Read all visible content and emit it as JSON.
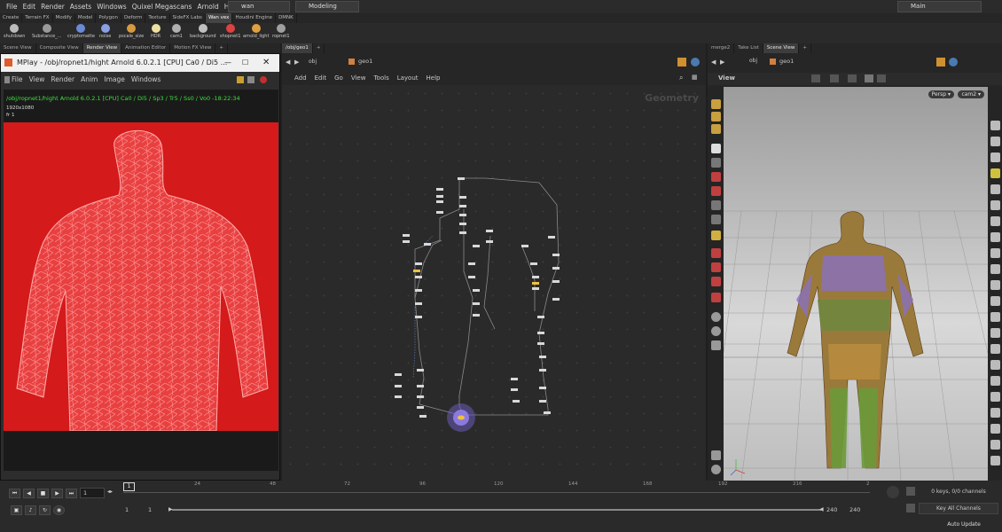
{
  "menubar": {
    "items": [
      "File",
      "Edit",
      "Render",
      "Assets",
      "Windows",
      "Quixel Megascans",
      "Arnold",
      "Help"
    ],
    "scene_name": "wan",
    "desktop": "Modeling",
    "main_label": "Main"
  },
  "shelf_tabs": [
    "Create",
    "Terrain FX",
    "Modify",
    "Model",
    "Polygon",
    "Deform",
    "Texture",
    "SideFX Labs",
    "Wan vex",
    "Houdini Engine",
    "DMNK"
  ],
  "shelf_active": "Wan vex",
  "shelf_tools": [
    {
      "label": "shutdown",
      "icon": "power-icon",
      "color": "#bbbbbb"
    },
    {
      "label": "Substance_...",
      "icon": "substance-icon",
      "color": "#9a9a9a"
    },
    {
      "label": "cryptomatte",
      "icon": "cryptomatte-icon",
      "color": "#6a8ad8"
    },
    {
      "label": "noise",
      "icon": "noise-icon",
      "color": "#8aa0e0"
    },
    {
      "label": "pscale_size",
      "icon": "pscale-icon",
      "color": "#d89a40"
    },
    {
      "label": "HDR",
      "icon": "light-bulb-icon",
      "color": "#f0e0a0"
    },
    {
      "label": "cam1",
      "icon": "camera-icon",
      "color": "#b0b0b0"
    },
    {
      "label": "background",
      "icon": "background-icon",
      "color": "#c0c0c0"
    },
    {
      "label": "shopnet1",
      "icon": "shop-icon",
      "color": "#e04040"
    },
    {
      "label": "arnold_light",
      "icon": "arnold-light-icon",
      "color": "#e0a040"
    },
    {
      "label": "ropnet1",
      "icon": "ropnet-icon",
      "color": "#a0a0a0"
    }
  ],
  "left_tabs": [
    "Scene View",
    "Composite View",
    "Render View",
    "Animation Editor",
    "Motion FX View"
  ],
  "left_tabs_active": "Render View",
  "mid_tabs": [
    "/obj/geo1"
  ],
  "right_tabs": [
    "merge2",
    "Take List",
    "Scene View"
  ],
  "right_tabs_active": "Scene View",
  "mplay": {
    "title": "MPlay - /obj/ropnet1/hight   Arnold 6.0.2.1 [CPU]  Ca0 / Di5 ...",
    "menu": [
      "File",
      "View",
      "Render",
      "Anim",
      "Image",
      "Windows"
    ],
    "info_line": "/obj/ropnet1/hight  Arnold 6.0.2.1 [CPU]  Ca0 / Di5 / Sp3 / Tr5 / Ss0 / Vo0 -18:22:34",
    "resolution": "1920x1080",
    "frame": "fr 1"
  },
  "network": {
    "path_obj": "obj",
    "path_geo": "geo1",
    "menu": [
      "Add",
      "Edit",
      "Go",
      "View",
      "Tools",
      "Layout",
      "Help"
    ],
    "context_label": "Geometry"
  },
  "scene": {
    "path_obj": "obj",
    "path_geo": "geo1",
    "view_label": "View",
    "persp_label": "Persp ▾",
    "cam_label": "cam2 ▾"
  },
  "timeline": {
    "frame": "1",
    "frame_marker": "1",
    "ticks": [
      "24",
      "48",
      "72",
      "96",
      "120",
      "144",
      "168",
      "192",
      "216",
      "2"
    ],
    "range_start": "1",
    "range_start2": "1",
    "range_end": "240",
    "range_end2": "240",
    "keys_info": "0 keys, 0/0 channels",
    "key_all_label": "Key All Channels",
    "auto_update_label": "Auto Update"
  }
}
